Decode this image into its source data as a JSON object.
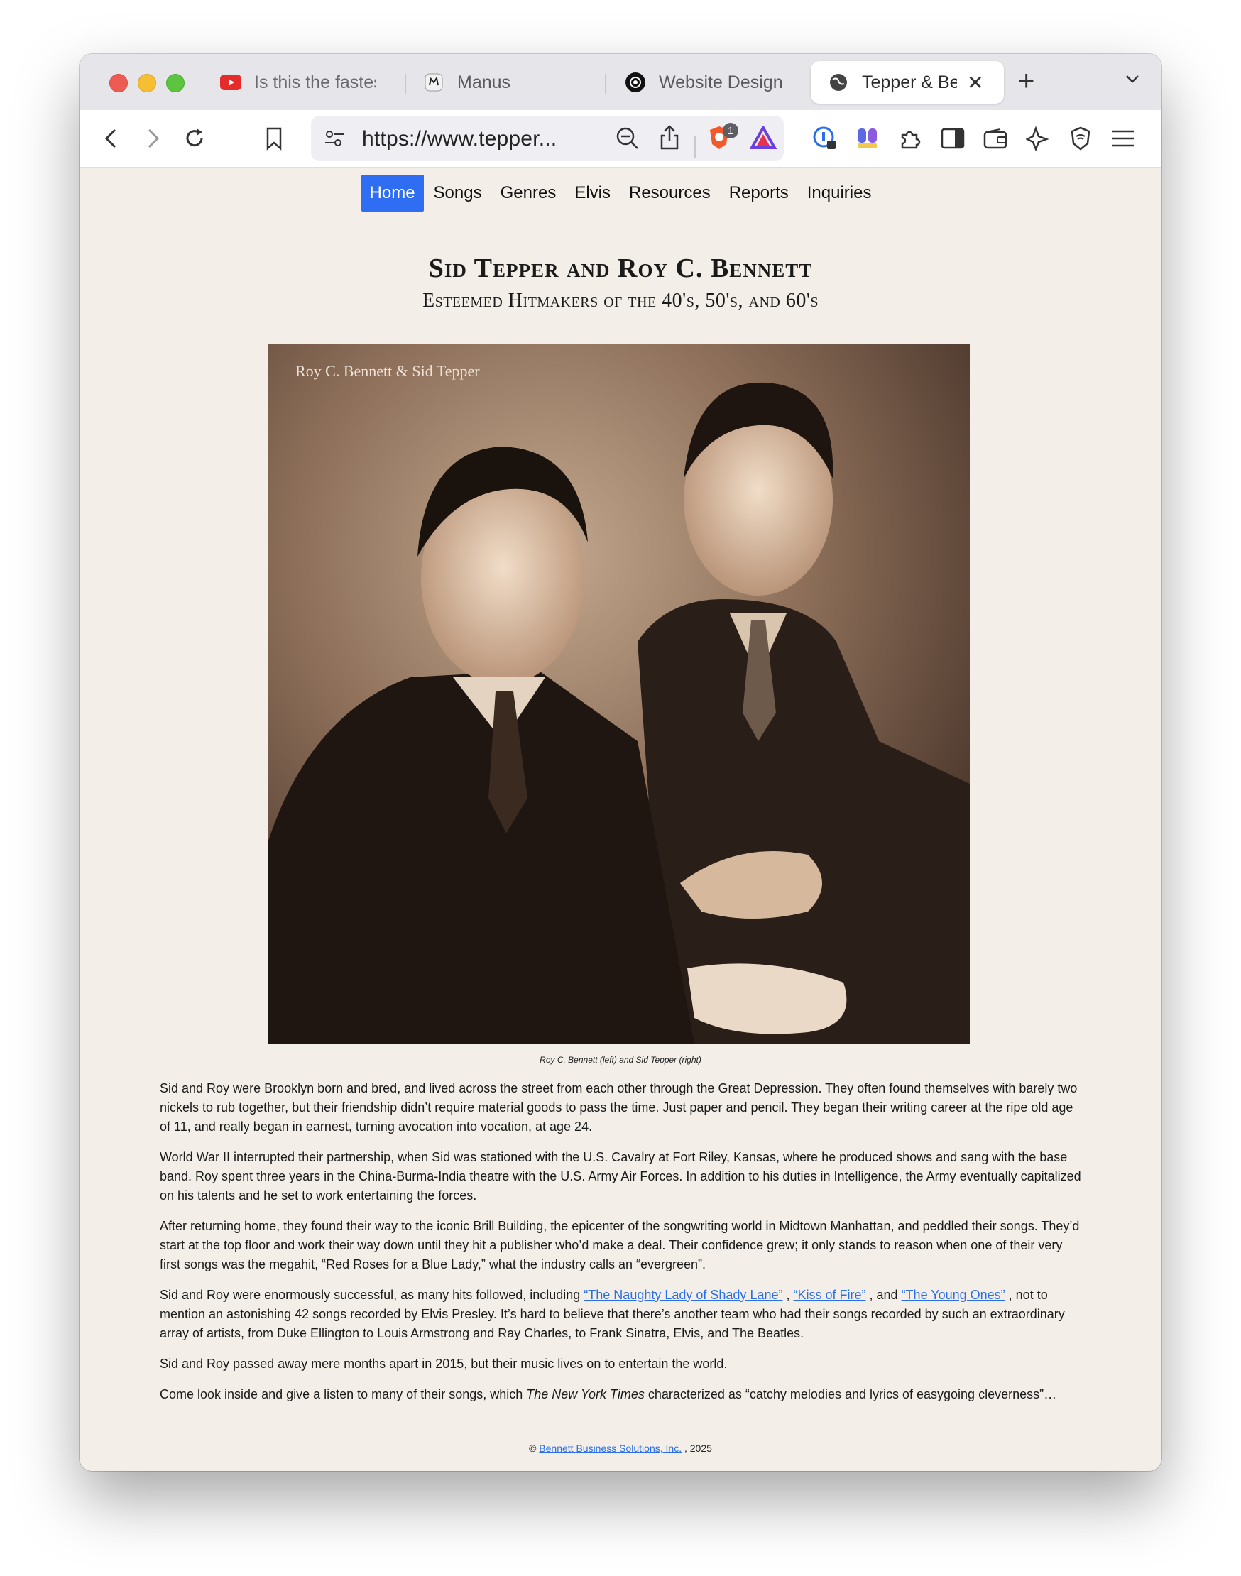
{
  "browser": {
    "tabs": [
      {
        "label": "Is this the fastes",
        "icon": "youtube-icon"
      },
      {
        "label": "Manus",
        "icon": "manus-icon"
      },
      {
        "label": "Website Design",
        "icon": "openai-icon"
      },
      {
        "label": "Tepper & Be",
        "icon": "globe-icon"
      }
    ],
    "url": "https://www.tepper...",
    "brave_badge": "1"
  },
  "nav": {
    "items": [
      "Home",
      "Songs",
      "Genres",
      "Elvis",
      "Resources",
      "Reports",
      "Inquiries"
    ]
  },
  "header": {
    "title": "Sid Tepper and Roy C. Bennett",
    "subtitle": "Esteemed Hitmakers of the 40's, 50's, and 60's"
  },
  "photo": {
    "label": "Roy C. Bennett & Sid Tepper",
    "caption": "Roy C. Bennett (left) and Sid Tepper (right)"
  },
  "content": {
    "p1": "Sid and Roy were Brooklyn born and bred, and lived across the street from each other through the Great Depression. They often found themselves with barely two nickels to rub together, but their friendship didn’t require material goods to pass the time. Just paper and pencil. They began their writing career at the ripe old age of 11, and really began in earnest, turning avocation into vocation, at age 24.",
    "p2": "World War II interrupted their partnership, when Sid was stationed with the U.S. Cavalry at Fort Riley, Kansas, where he produced shows and sang with the base band. Roy spent three years in the China-Burma-India theatre with the U.S. Army Air Forces. In addition to his duties in Intelligence, the Army eventually capitalized on his talents and he set to work entertaining the forces.",
    "p3": "After returning home, they found their way to the iconic Brill Building, the epicenter of the songwriting world in Midtown Manhattan, and peddled their songs. They’d start at the top floor and work their way down until they hit a publisher who’d make a deal. Their confidence grew; it only stands to reason when one of their very first songs was the megahit, “Red Roses for a Blue Lady,” what the industry calls an “evergreen”.",
    "p4_prefix": "Sid and Roy were enormously successful, as many hits followed, including ",
    "p4_link1": "“The Naughty Lady of Shady Lane”",
    "p4_sep1": " , ",
    "p4_link2": "“Kiss of Fire”",
    "p4_sep2": " , and ",
    "p4_link3": "“The Young Ones”",
    "p4_suffix": " , not to mention an astonishing 42 songs recorded by Elvis Presley. It’s hard to believe that there’s another team who had their songs recorded by such an extraordinary array of artists, from Duke Ellington to Louis Armstrong and Ray Charles, to Frank Sinatra, Elvis, and The Beatles.",
    "p5": "Sid and Roy passed away mere months apart in 2015, but their music lives on to entertain the world.",
    "p6_prefix": "Come look inside and give a listen to many of their songs, which ",
    "p6_italic": "The New York Times",
    "p6_suffix": " characterized as “catchy melodies and lyrics of easygoing cleverness”…"
  },
  "footer": {
    "copyright": "©",
    "company": "Bennett Business Solutions, Inc.",
    "year": " , 2025"
  },
  "colors": {
    "nav_active": "#2f6df2",
    "link": "#2a6ee8",
    "page_bg": "#f3efe8"
  }
}
